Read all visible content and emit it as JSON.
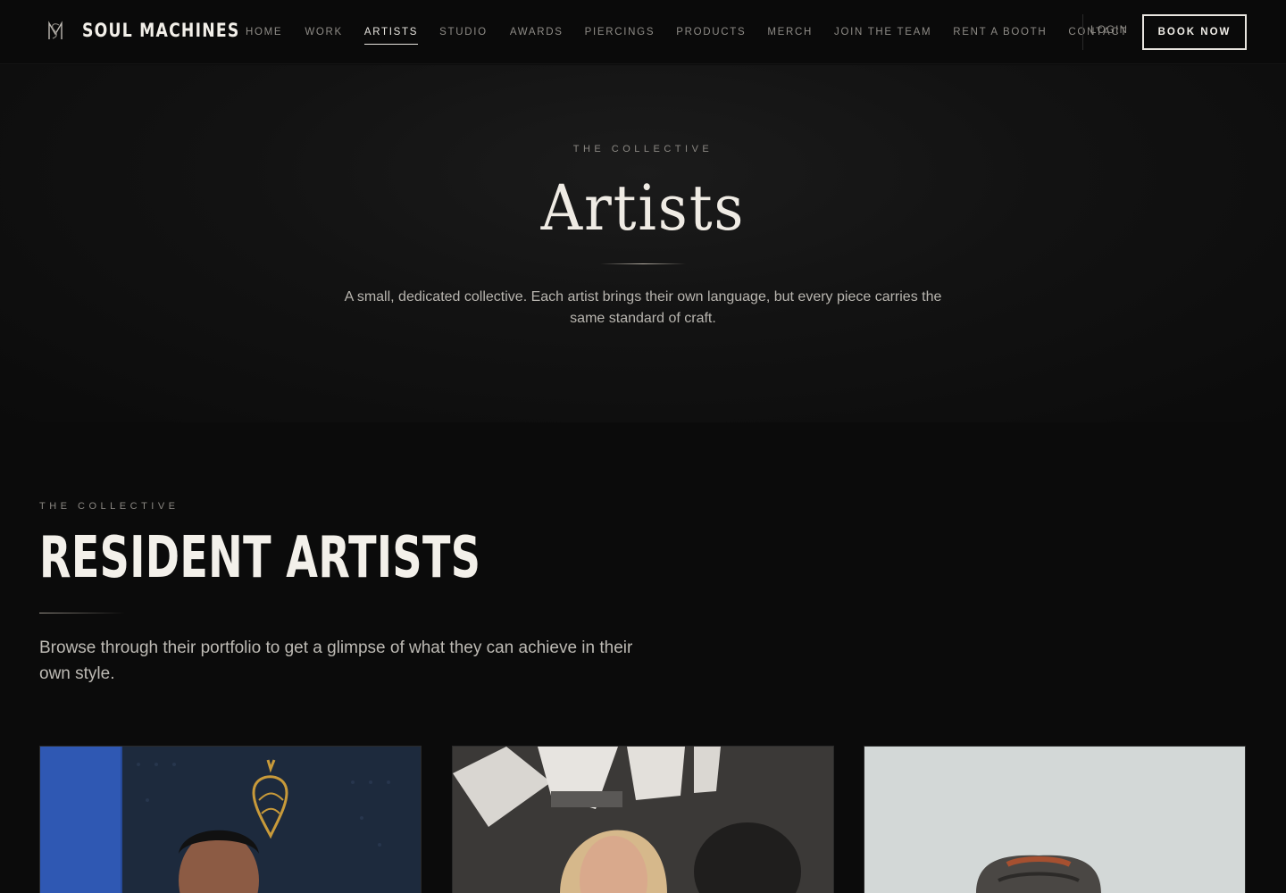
{
  "brand": {
    "name": "SOUL MACHINES",
    "logo_icon": "sm-monogram-icon"
  },
  "nav": {
    "items": [
      {
        "label": "HOME",
        "active": false
      },
      {
        "label": "WORK",
        "active": false
      },
      {
        "label": "ARTISTS",
        "active": true
      },
      {
        "label": "STUDIO",
        "active": false
      },
      {
        "label": "AWARDS",
        "active": false
      },
      {
        "label": "PIERCINGS",
        "active": false
      },
      {
        "label": "PRODUCTS",
        "active": false
      },
      {
        "label": "MERCH",
        "active": false
      },
      {
        "label": "JOIN THE TEAM",
        "active": false
      },
      {
        "label": "RENT A BOOTH",
        "active": false
      },
      {
        "label": "CONTACT",
        "active": false
      }
    ],
    "login_label": "LOGIN",
    "book_label": "BOOK NOW"
  },
  "hero": {
    "eyebrow": "THE COLLECTIVE",
    "title": "Artists",
    "description": "A small, dedicated collective. Each artist brings their own language, but every piece carries the same standard of craft."
  },
  "collective": {
    "eyebrow": "THE COLLECTIVE",
    "title": "RESIDENT ARTISTS",
    "description": "Browse through their portfolio to get a glimpse of what they can achieve in their own style."
  },
  "artists": [
    {
      "image": "artist-portrait-1"
    },
    {
      "image": "artist-portrait-2"
    },
    {
      "image": "artist-portrait-3"
    }
  ],
  "colors": {
    "background": "#0b0b0b",
    "text": "#e9e6e0",
    "muted": "#8e8b86"
  }
}
